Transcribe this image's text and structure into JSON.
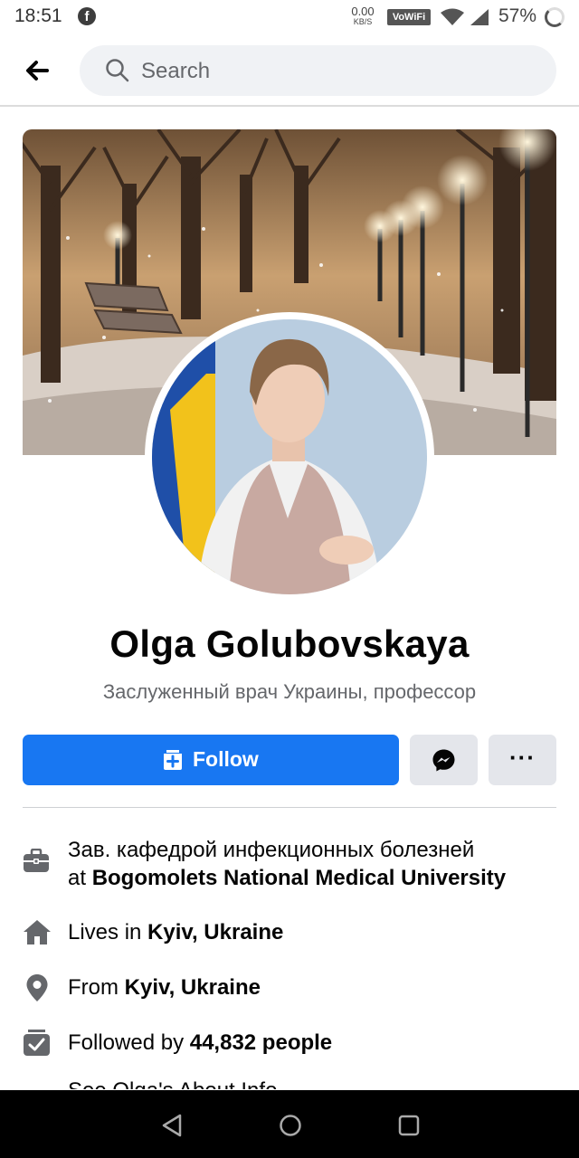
{
  "status_bar": {
    "time": "18:51",
    "speed_value": "0.00",
    "speed_unit": "KB/S",
    "vowifi": "VoWiFi",
    "battery_pct": "57%"
  },
  "header": {
    "search_placeholder": "Search"
  },
  "profile": {
    "name": "Olga  Golubovskaya",
    "bio": "Заслуженный врач Украины, профессор"
  },
  "actions": {
    "follow_label": "Follow",
    "more_label": "···"
  },
  "intro": {
    "work_line1": "Зав. кафедрой инфекционных болезней",
    "work_prefix": "at ",
    "work_place": "Bogomolets National Medical University",
    "lives_prefix": "Lives in ",
    "lives_place": "Kyiv, Ukraine",
    "from_prefix": "From ",
    "from_place": "Kyiv, Ukraine",
    "followed_prefix": "Followed by ",
    "followed_count": "44,832 people",
    "see_about": "See Olga's About Info"
  },
  "colors": {
    "accent": "#1877f2",
    "secondary_button": "#e4e6eb",
    "muted_text": "#65676b"
  }
}
